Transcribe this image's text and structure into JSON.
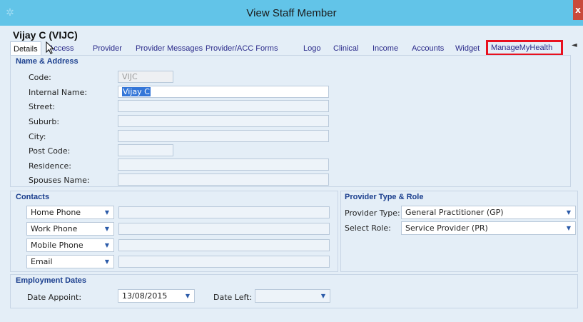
{
  "window": {
    "title": "View Staff Member",
    "close_label": "x"
  },
  "staff": {
    "name": "Vijay C (VIJC)"
  },
  "tabs": [
    {
      "label": "Details"
    },
    {
      "label": "Access"
    },
    {
      "label": "Provider"
    },
    {
      "label": "Provider Messages"
    },
    {
      "label": "Provider/ACC Forms"
    },
    {
      "label": "Logo"
    },
    {
      "label": "Clinical"
    },
    {
      "label": "Income"
    },
    {
      "label": "Accounts"
    },
    {
      "label": "Widget"
    },
    {
      "label": "ManageMyHealth"
    }
  ],
  "tab_scroll": "◄",
  "name_address": {
    "title": "Name & Address",
    "code_label": "Code:",
    "code_value": "VIJC",
    "internal_label": "Internal Name:",
    "internal_value": "Vijay C",
    "street_label": "Street:",
    "suburb_label": "Suburb:",
    "city_label": "City:",
    "postcode_label": "Post Code:",
    "residence_label": "Residence:",
    "spouses_label": "Spouses Name:"
  },
  "contacts": {
    "title": "Contacts",
    "items": [
      {
        "type": "Home Phone",
        "value": ""
      },
      {
        "type": "Work Phone",
        "value": ""
      },
      {
        "type": "Mobile Phone",
        "value": ""
      },
      {
        "type": "Email",
        "value": ""
      }
    ]
  },
  "provider": {
    "title": "Provider Type & Role",
    "type_label": "Provider Type:",
    "type_value": "General Practitioner (GP)",
    "role_label": "Select Role:",
    "role_value": "Service Provider (PR)"
  },
  "employment": {
    "title": "Employment Dates",
    "appoint_label": "Date Appoint:",
    "appoint_value": "13/08/2015",
    "left_label": "Date Left:",
    "left_value": ""
  },
  "colors": {
    "titlebar": "#62c4e8",
    "panel": "#e4eef7",
    "highlight": "#e8111f",
    "section_head": "#1b3f8e"
  }
}
